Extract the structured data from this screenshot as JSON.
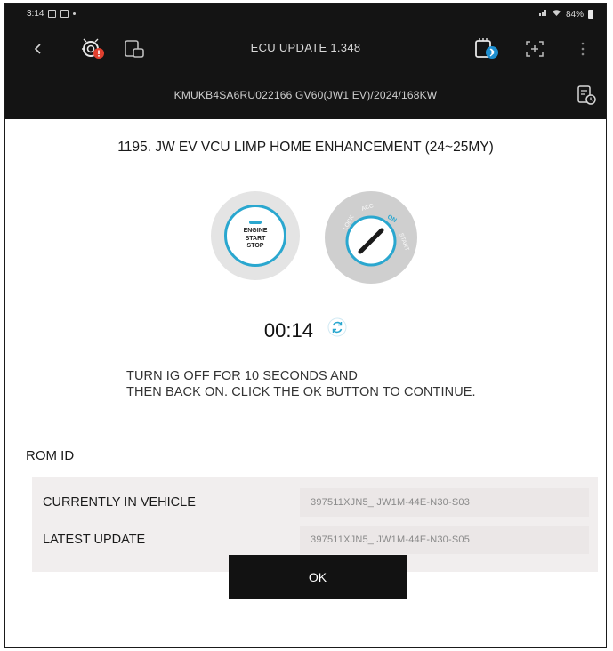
{
  "status_bar": {
    "time": "3:14",
    "battery": "84%"
  },
  "header": {
    "title": "ECU UPDATE 1.348",
    "icons": [
      "back-arrow-icon",
      "diagnostic-alert-icon",
      "vehicle-connect-icon",
      "vci-bluetooth-icon",
      "screen-capture-icon",
      "more-options-icon"
    ]
  },
  "vehicle": {
    "vin_info": "KMUKB4SA6RU022166  GV60(JW1 EV)/2024/168KW",
    "icon": "vehicle-report-icon"
  },
  "update": {
    "title": "1195. JW EV VCU LIMP HOME ENHANCEMENT (24~25MY)",
    "engine_button_lines": [
      "ENGINE",
      "START",
      "STOP"
    ],
    "ignition_labels": [
      "LOCK",
      "ACC",
      "ON",
      "START"
    ],
    "timer": "00:14",
    "instruction_line1": "TURN IG OFF FOR 10 SECONDS AND",
    "instruction_line2": "THEN BACK ON. CLICK THE OK BUTTON TO CONTINUE."
  },
  "rom": {
    "label": "ROM ID",
    "rows": [
      {
        "label": "CURRENTLY IN VEHICLE",
        "value": "397511XJN5_ JW1M-44E-N30-S03"
      },
      {
        "label": "LATEST UPDATE",
        "value": "397511XJN5_ JW1M-44E-N30-S05"
      }
    ]
  },
  "actions": {
    "ok_label": "OK"
  },
  "colors": {
    "accent": "#2aa7cf",
    "dark_bar": "#141414",
    "alert_red": "#e0402f"
  }
}
